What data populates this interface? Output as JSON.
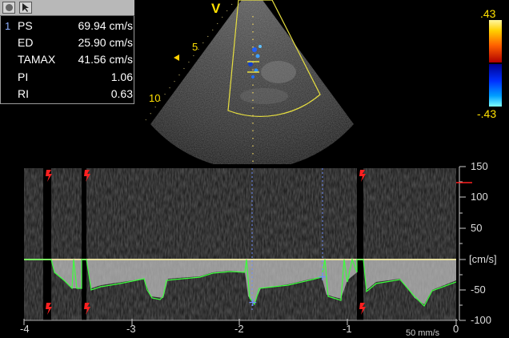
{
  "measurements": {
    "index": "1",
    "rows": [
      {
        "label": "PS",
        "value": "69.94 cm/s"
      },
      {
        "label": "ED",
        "value": "25.90 cm/s"
      },
      {
        "label": "TAMAX",
        "value": "41.56 cm/s"
      },
      {
        "label": "PI",
        "value": "1.06"
      },
      {
        "label": "RI",
        "value": "0.63"
      }
    ]
  },
  "sector": {
    "orientation_marker": "V",
    "depth_labels": [
      "5",
      "10"
    ]
  },
  "colorbar": {
    "top_label": ".43",
    "bottom_label": "-.43"
  },
  "spectral": {
    "y_ticks": [
      "150",
      "100",
      "50",
      "[cm/s]",
      "-50",
      "-100"
    ],
    "x_ticks": [
      "-4",
      "-3",
      "-2",
      "-1",
      "0"
    ],
    "sweep_speed": "50 mm/s",
    "colors": {
      "trace": "#3cff3c",
      "baseline": "#e8e0a0",
      "cursor": "#7090ff",
      "marker": "#ff2020"
    }
  }
}
